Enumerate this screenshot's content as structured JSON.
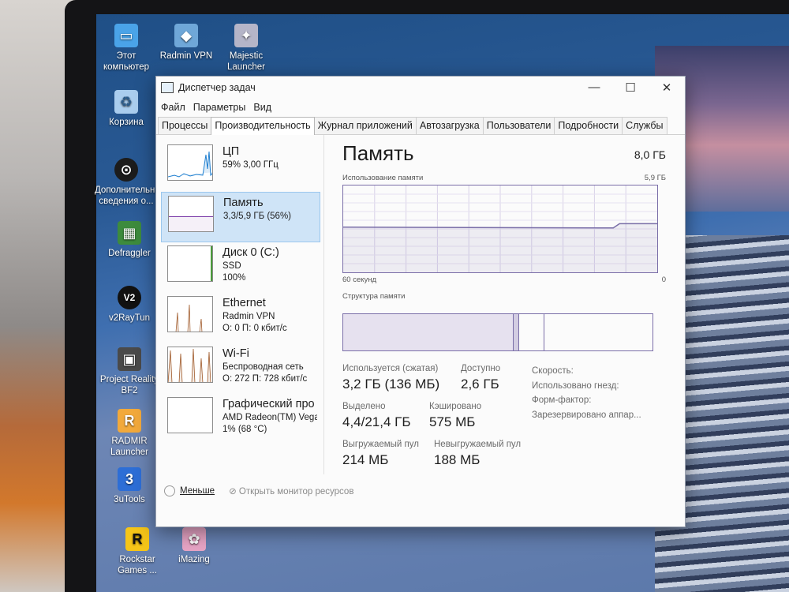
{
  "desktop_icons": [
    {
      "label": "Этот компьютер",
      "icon": "this-pc-icon",
      "color": "#4aa3e8"
    },
    {
      "label": "Radmin VPN",
      "icon": "radmin-vpn-icon",
      "color": "#6fa7d8"
    },
    {
      "label": "Majestic Launcher",
      "icon": "majestic-launcher-icon",
      "color": "#b5b5c8"
    },
    {
      "label": "Корзина",
      "icon": "recycle-bin-icon",
      "color": "#aacdee"
    },
    {
      "label": "Дополнительные сведения о...",
      "icon": "info-icon",
      "color": "#1c1c1c"
    },
    {
      "label": "Defraggler",
      "icon": "defraggler-icon",
      "color": "#3d8b3d"
    },
    {
      "label": "v2RayTun",
      "icon": "v2raytun-icon",
      "color": "#111111"
    },
    {
      "label": "Project Reality BF2",
      "icon": "project-reality-icon",
      "color": "#4a4a4a"
    },
    {
      "label": "RADMIR Launcher",
      "icon": "radmir-launcher-icon",
      "color": "#f2a93b"
    },
    {
      "label": "3uTools",
      "icon": "3utools-icon",
      "color": "#2d6ed6"
    },
    {
      "label": "Rockstar Games ...",
      "icon": "rockstar-games-icon",
      "color": "#f5c518"
    },
    {
      "label": "iMazing",
      "icon": "imazing-icon",
      "color": "#e8a5c6"
    }
  ],
  "window": {
    "title": "Диспетчер задач",
    "controls": {
      "minimize": "—",
      "maximize": "☐",
      "close": "✕"
    },
    "menu": [
      "Файл",
      "Параметры",
      "Вид"
    ],
    "tabs": [
      "Процессы",
      "Производительность",
      "Журнал приложений",
      "Автозагрузка",
      "Пользователи",
      "Подробности",
      "Службы"
    ],
    "active_tab": "Производительность"
  },
  "sidebar": [
    {
      "title": "ЦП",
      "line1": "59% 3,00 ГГц",
      "line2": "",
      "color": "#1f7fd0",
      "level": 0.59
    },
    {
      "title": "Память",
      "line1": "3,3/5,9 ГБ (56%)",
      "line2": "",
      "color": "#7a3aa8",
      "level": 0.56
    },
    {
      "title": "Диск 0 (C:)",
      "line1": "SSD",
      "line2": "100%",
      "color": "#4a9a3a",
      "level": 1.0
    },
    {
      "title": "Ethernet",
      "line1": "Radmin VPN",
      "line2": "О: 0 П: 0 кбит/с",
      "color": "#a05a2a",
      "level": 0.0
    },
    {
      "title": "Wi-Fi",
      "line1": "Беспроводная сеть",
      "line2": "О: 272 П: 728 кбит/с",
      "color": "#a05a2a",
      "level": 0.5
    },
    {
      "title": "Графический про",
      "line1": "AMD Radeon(TM) Vega",
      "line2": "1% (68 °C)",
      "color": "#1f7fd0",
      "level": 0.01
    }
  ],
  "memory": {
    "title": "Память",
    "capacity": "8,0 ГБ",
    "usage_label": "Использование памяти",
    "usage_max": "5,9 ГБ",
    "axis_left": "60 секунд",
    "axis_right": "0",
    "composition_label": "Структура памяти",
    "usage_level_start": 0.52,
    "usage_level_end": 0.56,
    "stats": {
      "in_use_label": "Используется (сжатая)",
      "in_use_value": "3,2 ГБ (136 МБ)",
      "available_label": "Доступно",
      "available_value": "2,6 ГБ",
      "committed_label": "Выделено",
      "committed_value": "4,4/21,4 ГБ",
      "cached_label": "Кэшировано",
      "cached_value": "575 МБ",
      "paged_label": "Выгружаемый пул",
      "paged_value": "214 МБ",
      "nonpaged_label": "Невыгружаемый пул",
      "nonpaged_value": "188 МБ"
    },
    "extra": [
      "Скорость:",
      "Использовано гнезд:",
      "Форм-фактор:",
      "Зарезервировано аппар..."
    ]
  },
  "footer": {
    "less": "Меньше",
    "resmon": "Открыть монитор ресурсов"
  }
}
